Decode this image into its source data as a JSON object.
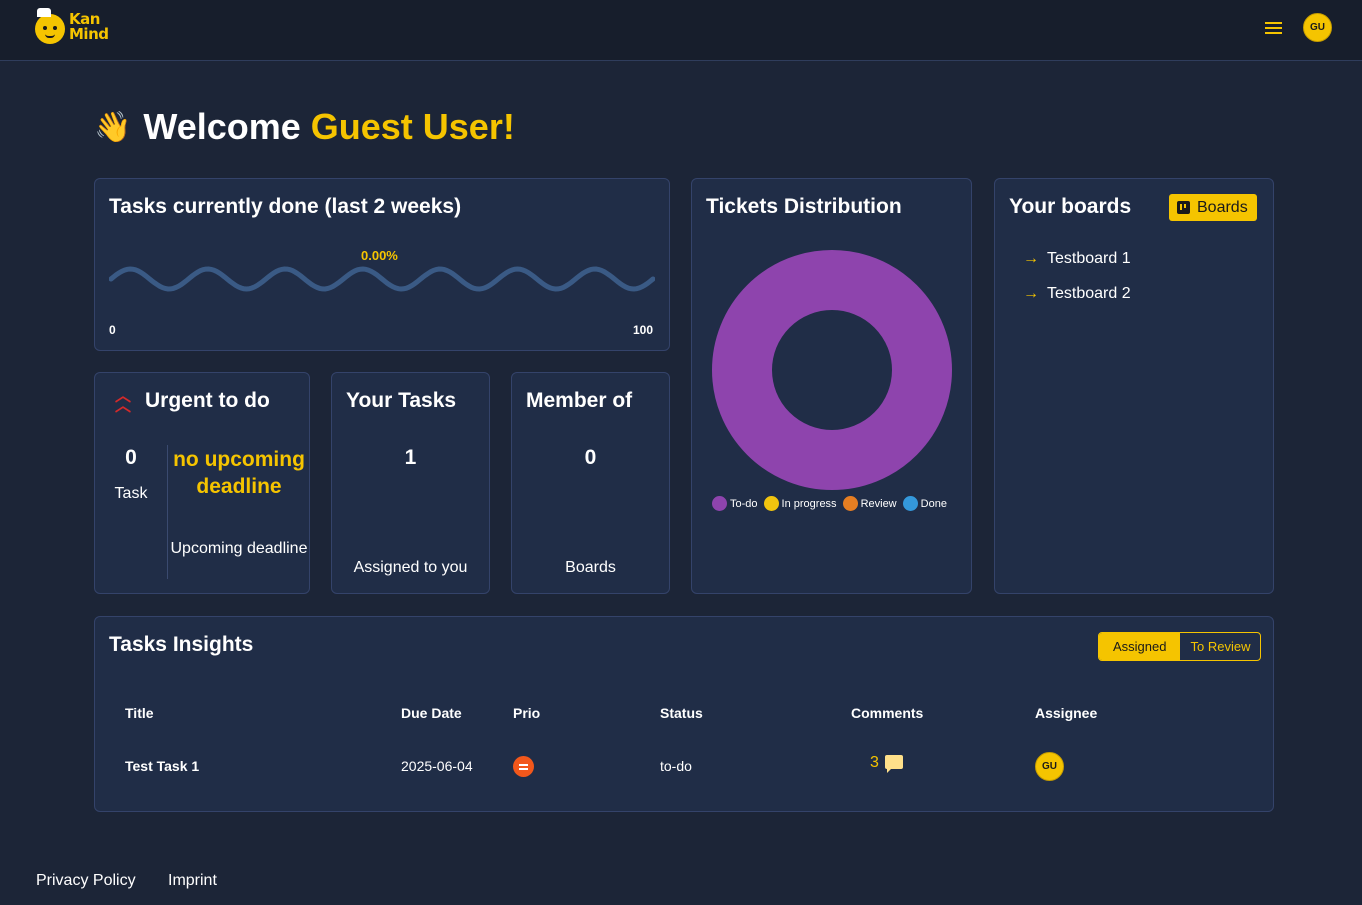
{
  "header": {
    "logo_text_line1": "Kan",
    "logo_text_line2": "Mind",
    "avatar_initials": "GU"
  },
  "welcome": {
    "greeting": "Welcome",
    "user_name": "Guest User!"
  },
  "tasks_done": {
    "title": "Tasks currently done (last 2 weeks)",
    "percent_label": "0.00%",
    "scale_min": "0",
    "scale_max": "100",
    "progress_fraction": 0
  },
  "tickets_distribution": {
    "title": "Tickets Distribution",
    "legend": [
      {
        "label": "To-do",
        "color": "#8e44ad"
      },
      {
        "label": "In progress",
        "color": "#f1c40f"
      },
      {
        "label": "Review",
        "color": "#e67e22"
      },
      {
        "label": "Done",
        "color": "#3498db"
      }
    ],
    "counts": {
      "to_do": 1,
      "in_progress": 0,
      "review": 0,
      "done": 0
    }
  },
  "your_boards": {
    "title": "Your boards",
    "button_label": "Boards",
    "items": [
      {
        "label": "Testboard 1"
      },
      {
        "label": "Testboard 2"
      }
    ]
  },
  "urgent": {
    "title": "Urgent to do",
    "count": "0",
    "count_label": "Task",
    "deadline_text": "no upcoming deadline",
    "deadline_label": "Upcoming deadline"
  },
  "your_tasks": {
    "title": "Your Tasks",
    "count": "1",
    "label": "Assigned to you"
  },
  "member_of": {
    "title": "Member of",
    "count": "0",
    "label": "Boards"
  },
  "insights": {
    "title": "Tasks Insights",
    "toggle": {
      "active": "Assigned",
      "inactive": "To Review"
    },
    "columns": [
      "Title",
      "Due Date",
      "Prio",
      "Status",
      "Comments",
      "Assignee"
    ],
    "rows": [
      {
        "title": "Test Task 1",
        "due_date": "2025-06-04",
        "prio": "medium",
        "status": "to-do",
        "comments": "3",
        "assignee": "GU"
      }
    ]
  },
  "footer": {
    "privacy": "Privacy Policy",
    "imprint": "Imprint"
  },
  "colors": {
    "accent": "#f5c400",
    "background": "#1c2537",
    "card": "#202d47",
    "urgent": "#d42a2a",
    "prio_medium": "#f2571b"
  }
}
